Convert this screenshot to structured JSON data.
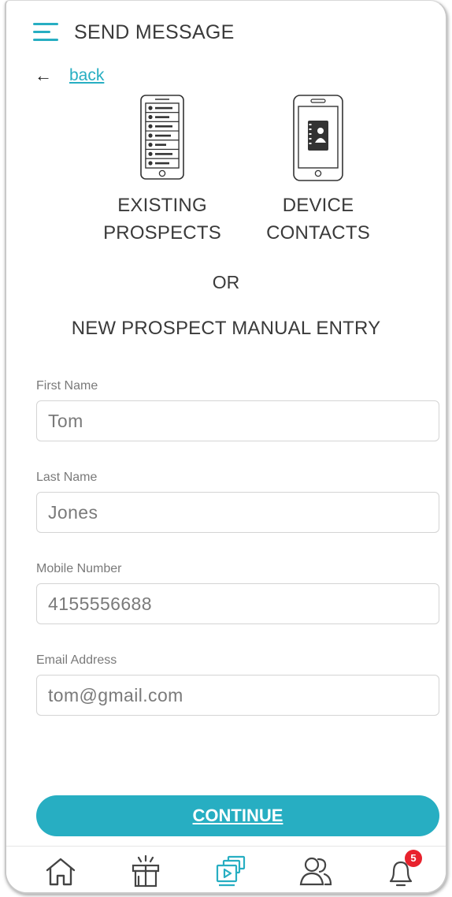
{
  "header": {
    "title": "SEND MESSAGE"
  },
  "back": {
    "arrow": "←",
    "label": "back"
  },
  "options": [
    {
      "line1": "EXISTING",
      "line2": "PROSPECTS",
      "icon": "phone-list-icon"
    },
    {
      "line1": "DEVICE",
      "line2": "CONTACTS",
      "icon": "phone-contacts-icon"
    }
  ],
  "or_label": "OR",
  "manual_entry_label": "NEW PROSPECT MANUAL ENTRY",
  "form": {
    "first_name": {
      "label": "First Name",
      "value": "Tom"
    },
    "last_name": {
      "label": "Last Name",
      "value": "Jones"
    },
    "mobile": {
      "label": "Mobile Number",
      "value": "4155556688"
    },
    "email": {
      "label": "Email Address",
      "value": "tom@gmail.com"
    }
  },
  "continue_label": "CONTINUE",
  "nav": {
    "items": [
      "home-icon",
      "gift-icon",
      "media-icon",
      "people-icon",
      "bell-icon"
    ],
    "notifications_count": "5"
  },
  "colors": {
    "accent": "#27aec2",
    "badge": "#e8222d",
    "text": "#3a3a3a"
  }
}
